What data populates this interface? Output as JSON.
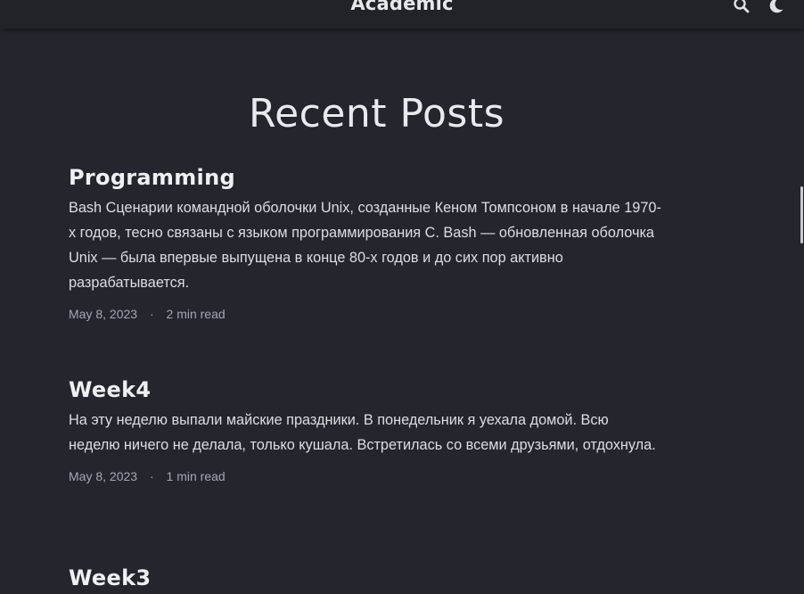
{
  "navbar": {
    "brand": "Academic",
    "search_icon": "search-icon",
    "theme_icon": "moon-icon"
  },
  "page": {
    "title": "Recent Posts"
  },
  "posts": [
    {
      "title": "Programming",
      "summary": "Bash Сценарии командной оболочки Unix, созданные Кеном Томпсоном в начале 1970-х годов, тесно связаны с языком программирования C. Bash — обновленная оболочка Unix — была впервые выпущена в конце 80-х годов и до сих пор активно разрабатывается.",
      "date": "May 8, 2023",
      "separator": "·",
      "reading_time": "2 min read"
    },
    {
      "title": "Week4",
      "summary": "На эту неделю выпали майские праздники. В понедельник я уехала домой. Всю неделю ничего не делала, только кушала. Встретилась со всеми друзьями, отдохнула.",
      "date": "May 8, 2023",
      "separator": "·",
      "reading_time": "1 min read"
    },
    {
      "title": "Week3"
    }
  ],
  "colors": {
    "background": "#24262d",
    "navbar": "#212329",
    "text": "#e2e4e9",
    "meta": "#a3a7b0"
  }
}
